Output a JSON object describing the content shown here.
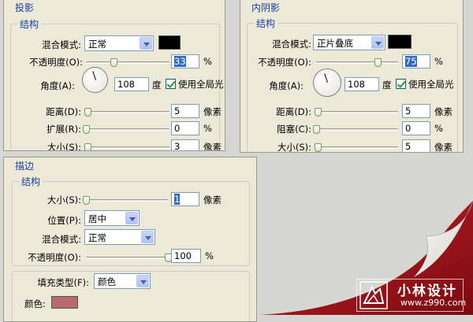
{
  "drop_shadow": {
    "title": "投影",
    "group_title": "结构",
    "blend_mode_label": "混合模式:",
    "blend_mode_value": "正常",
    "blend_color": "#000000",
    "opacity_label": "不透明度(O):",
    "opacity_value": "33",
    "opacity_unit": "%",
    "opacity_fraction": 0.33,
    "angle_label": "角度(A):",
    "angle_value": "108",
    "angle_unit": "度",
    "global_light_label": "使用全局光",
    "global_light_checked": true,
    "distance_label": "距离(D):",
    "distance_value": "5",
    "distance_unit": "像素",
    "distance_fraction": 0.02,
    "spread_label": "扩展(R):",
    "spread_value": "0",
    "spread_unit": "%",
    "spread_fraction": 0.0,
    "size_label": "大小(S):",
    "size_value": "3",
    "size_unit": "像素",
    "size_fraction": 0.015
  },
  "inner_shadow": {
    "title": "内阴影",
    "group_title": "结构",
    "blend_mode_label": "混合模式:",
    "blend_mode_value": "正片叠底",
    "blend_color": "#000000",
    "opacity_label": "不透明度(O):",
    "opacity_value": "75",
    "opacity_unit": "%",
    "opacity_fraction": 0.75,
    "angle_label": "角度(A):",
    "angle_value": "108",
    "angle_unit": "度",
    "global_light_label": "使用全局光",
    "global_light_checked": true,
    "distance_label": "距离(D):",
    "distance_value": "5",
    "distance_unit": "像素",
    "distance_fraction": 0.02,
    "choke_label": "阻塞(C):",
    "choke_value": "0",
    "choke_unit": "%",
    "choke_fraction": 0.0,
    "size_label": "大小(S):",
    "size_value": "5",
    "size_unit": "像素",
    "size_fraction": 0.02
  },
  "stroke": {
    "title": "描边",
    "group_title": "结构",
    "size_label": "大小(S):",
    "size_value": "1",
    "size_unit": "像素",
    "size_fraction": 0.0,
    "position_label": "位置(P):",
    "position_value": "居中",
    "blend_mode_label": "混合模式:",
    "blend_mode_value": "正常",
    "opacity_label": "不透明度(O):",
    "opacity_value": "100",
    "opacity_unit": "%",
    "opacity_fraction": 1.0,
    "fill_type_label": "填充类型(F):",
    "fill_type_value": "颜色",
    "color_label": "颜色:",
    "color_value": "#b86b6e"
  },
  "logo": {
    "title": "小林设计",
    "url": "www.z990.com"
  },
  "colors": {
    "accent_red": "#a8141c",
    "group_title_blue": "#1a3fa3"
  }
}
